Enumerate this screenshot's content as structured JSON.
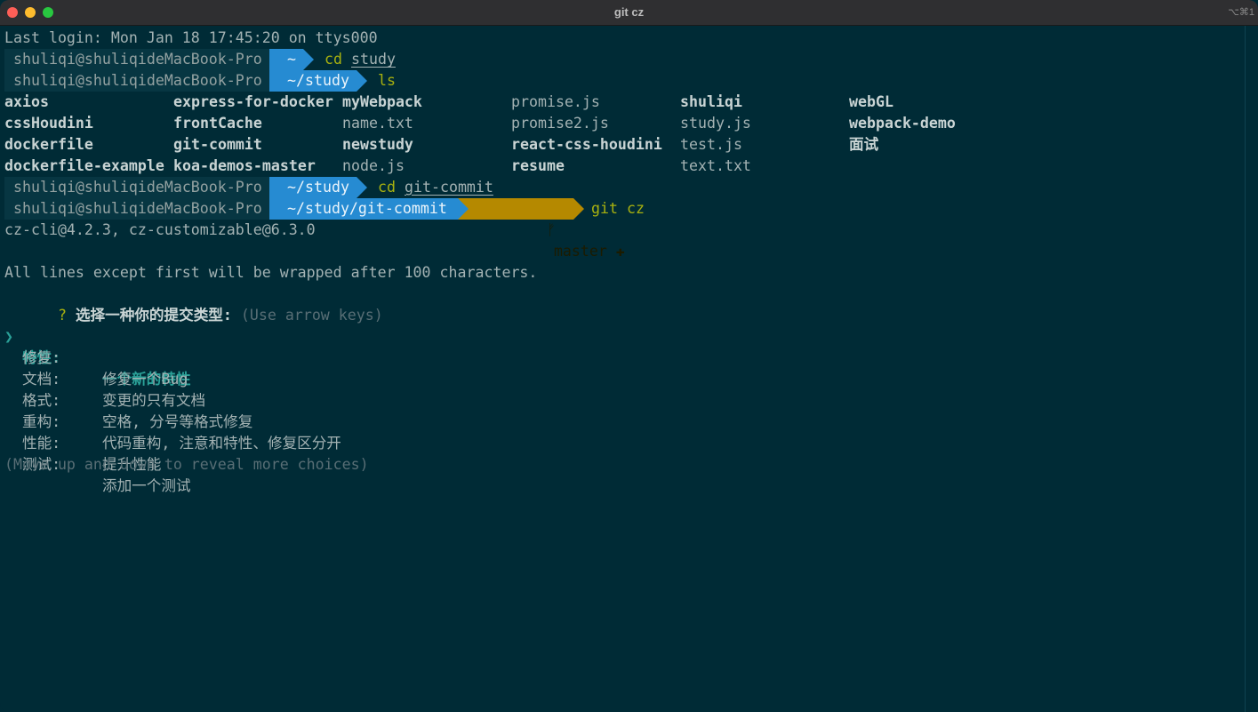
{
  "window": {
    "title": "git cz",
    "shortcut": "⌥⌘1"
  },
  "theme": {
    "background": "#002b36",
    "segment_user": "#073642",
    "segment_dir": "#268bd2",
    "segment_git": "#b58900",
    "accent": "#2aa198"
  },
  "terminal": {
    "last_login": "Last login: Mon Jan 18 17:45:20 on ttys000",
    "prompts": [
      {
        "user": "shuliqi@shuliqideMacBook-Pro",
        "dir": "~",
        "cmd": "cd",
        "arg": "study"
      },
      {
        "user": "shuliqi@shuliqideMacBook-Pro",
        "dir": "~/study",
        "cmd": "ls",
        "arg": ""
      },
      {
        "user": "shuliqi@shuliqideMacBook-Pro",
        "dir": "~/study",
        "cmd": "cd",
        "arg": "git-commit"
      },
      {
        "user": "shuliqi@shuliqideMacBook-Pro",
        "dir": "~/study/git-commit",
        "git_icon": "ᚠ",
        "branch": "master ✚",
        "cmd": "git cz",
        "arg": ""
      }
    ],
    "ls_rows": [
      [
        "axios",
        "express-for-docker",
        "myWebpack",
        "promise.js",
        "shuliqi",
        "webGL"
      ],
      [
        "cssHoudini",
        "frontCache",
        "name.txt",
        "promise2.js",
        "study.js",
        "webpack-demo"
      ],
      [
        "dockerfile",
        "git-commit",
        "newstudy",
        "react-css-houdini",
        "test.js",
        "面试"
      ],
      [
        "dockerfile-example",
        "koa-demos-master",
        "node.js",
        "resume",
        "text.txt",
        ""
      ]
    ],
    "version_line": "cz-cli@4.2.3, cz-customizable@6.3.0",
    "wrap_notice": "All lines except first will be wrapped after 100 characters.",
    "question_mark": "?",
    "question": "选择一种你的提交类型:",
    "question_hint": "(Use arrow keys)",
    "pointer": "❯",
    "choices": [
      {
        "key": "特性:",
        "desc": "一个新的特性"
      },
      {
        "key": "修复:",
        "desc": "修复一个Bug"
      },
      {
        "key": "文档:",
        "desc": "变更的只有文档"
      },
      {
        "key": "格式:",
        "desc": "空格, 分号等格式修复"
      },
      {
        "key": "重构:",
        "desc": "代码重构, 注意和特性、修复区分开"
      },
      {
        "key": "性能:",
        "desc": "提升性能"
      },
      {
        "key": "测试:",
        "desc": "添加一个测试"
      }
    ],
    "more_hint": "(Move up and down to reveal more choices)"
  }
}
